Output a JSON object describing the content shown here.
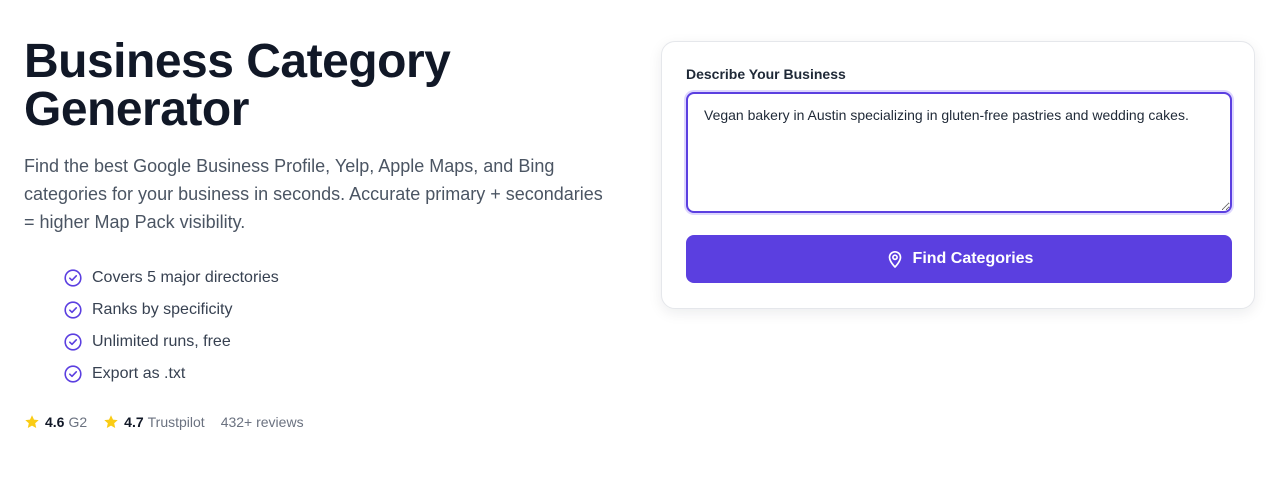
{
  "hero": {
    "title": "Business Category Generator",
    "subtitle": "Find the best Google Business Profile, Yelp, Apple Maps, and Bing categories for your business in seconds. Accurate primary + secondaries = higher Map Pack visibility."
  },
  "features": [
    {
      "label": "Covers 5 major directories",
      "icon": "check-circle-icon"
    },
    {
      "label": "Ranks by specificity",
      "icon": "check-circle-icon"
    },
    {
      "label": "Unlimited runs, free",
      "icon": "check-circle-icon"
    },
    {
      "label": "Export as .txt",
      "icon": "check-circle-icon"
    }
  ],
  "ratings": {
    "items": [
      {
        "value": "4.6",
        "source": "G2",
        "icon": "star-icon"
      },
      {
        "value": "4.7",
        "source": "Trustpilot",
        "icon": "star-icon"
      }
    ],
    "reviews": "432+ reviews"
  },
  "form": {
    "label": "Describe Your Business",
    "textarea_value": "Vegan bakery in Austin specializing in gluten-free pastries and wedding cakes.",
    "button_label": "Find Categories",
    "button_icon": "map-pin-icon"
  },
  "colors": {
    "accent": "#5b3fe0",
    "star": "#facc15",
    "check": "#5b3fe0"
  }
}
